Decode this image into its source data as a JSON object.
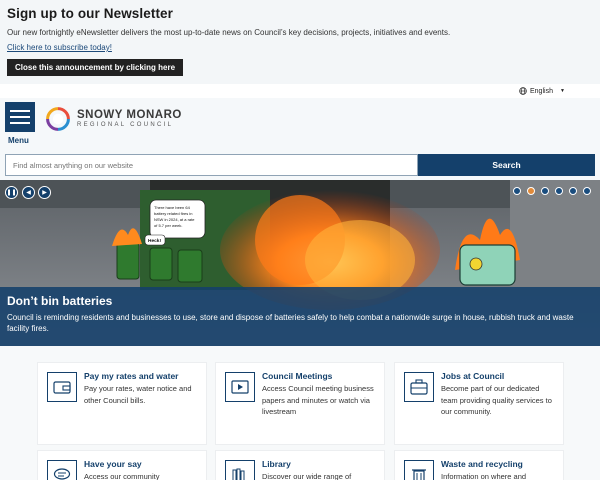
{
  "announcement": {
    "title": "Sign up to our Newsletter",
    "body": "Our new fortnightly eNewsletter delivers the most up-to-date news on Council’s key decisions, projects, initiatives and events.",
    "subscribe_link": "Click here to subscribe today!",
    "close_label": "Close this announcement by clicking here"
  },
  "language": {
    "label": "English",
    "icon": "globe-icon"
  },
  "header": {
    "menu_label": "Menu",
    "logo_line1": "SNOWY MONARO",
    "logo_line2": "REGIONAL COUNCIL"
  },
  "search": {
    "placeholder": "Find almost anything on our website",
    "button_label": "Search"
  },
  "hero": {
    "title": "Don’t bin batteries",
    "description": "Council is reminding residents and businesses to use, store and dispose of batteries safely to help combat a nationwide surge in house, rubbish truck and waste facility fires.",
    "speech_bubble": "There have been 64 battery related fires in NSW in 2024, at a rate of 5.7 per week.",
    "heck_label": "Heck!",
    "slide_count": 6,
    "active_slide": 2
  },
  "cards": [
    {
      "title": "Pay my rates and water",
      "desc": "Pay your rates, water notice and other Council bills.",
      "icon": "wallet-icon"
    },
    {
      "title": "Council Meetings",
      "desc": "Access Council meeting business papers and minutes or watch via livestream",
      "icon": "video-play-icon"
    },
    {
      "title": "Jobs at Council",
      "desc": "Become part of our dedicated team providing quality services to our community.",
      "icon": "briefcase-icon"
    },
    {
      "title": "Have your say",
      "desc": "Access our community",
      "icon": "speech-bubble-icon"
    },
    {
      "title": "Library",
      "desc": "Discover our wide range of",
      "icon": "books-icon"
    },
    {
      "title": "Waste and recycling",
      "desc": "Information on where and",
      "icon": "trash-bin-icon"
    }
  ],
  "colors": {
    "brand": "#14406b",
    "accent_dot": "#e08a3a"
  }
}
